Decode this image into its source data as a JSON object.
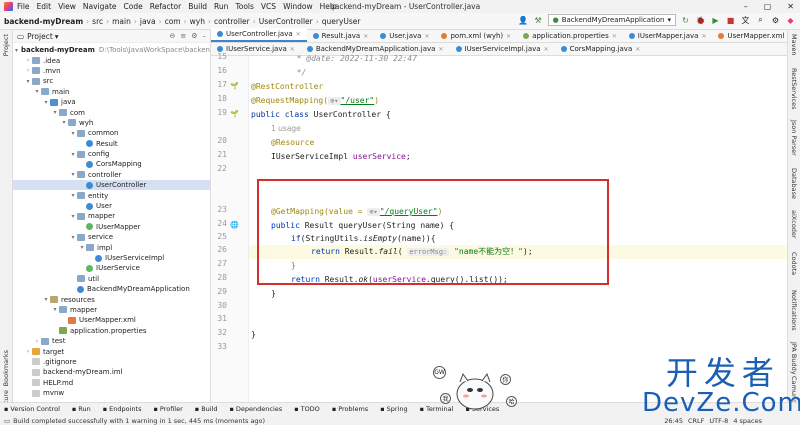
{
  "menubar": {
    "items": [
      "File",
      "Edit",
      "View",
      "Navigate",
      "Code",
      "Refactor",
      "Build",
      "Run",
      "Tools",
      "VCS",
      "Window",
      "Help"
    ],
    "window_title": "backend-myDream - UserController.java"
  },
  "breadcrumb": [
    "backend-myDream",
    "src",
    "main",
    "java",
    "com",
    "wyh",
    "controller",
    "UserController",
    "queryUser"
  ],
  "run_config": "BackendMyDreamApplication",
  "project_panel": {
    "title": "Project"
  },
  "tree": [
    {
      "d": 0,
      "t": "v",
      "i": "folder",
      "label": "backend-myDream",
      "path": "D:\\Tools\\JavaWorkSpace\\backend-m"
    },
    {
      "d": 1,
      "t": ">",
      "i": "folder",
      "label": ".idea"
    },
    {
      "d": 1,
      "t": ">",
      "i": "folder",
      "label": ".mvn"
    },
    {
      "d": 1,
      "t": "v",
      "i": "folder",
      "label": "src"
    },
    {
      "d": 2,
      "t": "v",
      "i": "folder",
      "label": "main"
    },
    {
      "d": 3,
      "t": "v",
      "i": "src",
      "label": "java"
    },
    {
      "d": 4,
      "t": "v",
      "i": "folder",
      "label": "com"
    },
    {
      "d": 5,
      "t": "v",
      "i": "folder",
      "label": "wyh"
    },
    {
      "d": 6,
      "t": "v",
      "i": "folder",
      "label": "common"
    },
    {
      "d": 7,
      "t": "",
      "i": "class",
      "label": "Result"
    },
    {
      "d": 6,
      "t": "v",
      "i": "folder",
      "label": "config"
    },
    {
      "d": 7,
      "t": "",
      "i": "class",
      "label": "CorsMapping"
    },
    {
      "d": 6,
      "t": "v",
      "i": "folder",
      "label": "controller"
    },
    {
      "d": 7,
      "t": "",
      "i": "class",
      "label": "UserController"
    },
    {
      "d": 6,
      "t": "v",
      "i": "folder",
      "label": "entity"
    },
    {
      "d": 7,
      "t": "",
      "i": "class",
      "label": "User"
    },
    {
      "d": 6,
      "t": "v",
      "i": "folder",
      "label": "mapper"
    },
    {
      "d": 7,
      "t": "",
      "i": "iface",
      "label": "IUserMapper"
    },
    {
      "d": 6,
      "t": "v",
      "i": "folder",
      "label": "service"
    },
    {
      "d": 7,
      "t": "v",
      "i": "folder",
      "label": "impl"
    },
    {
      "d": 8,
      "t": "",
      "i": "class",
      "label": "IUserServiceImpl"
    },
    {
      "d": 7,
      "t": "",
      "i": "iface",
      "label": "IUserService"
    },
    {
      "d": 6,
      "t": "",
      "i": "folder",
      "label": "util"
    },
    {
      "d": 6,
      "t": "",
      "i": "class",
      "label": "BackendMyDreamApplication"
    },
    {
      "d": 3,
      "t": "v",
      "i": "res",
      "label": "resources"
    },
    {
      "d": 4,
      "t": "v",
      "i": "folder",
      "label": "mapper"
    },
    {
      "d": 5,
      "t": "",
      "i": "xml",
      "label": "UserMapper.xml"
    },
    {
      "d": 4,
      "t": "",
      "i": "prop",
      "label": "application.properties"
    },
    {
      "d": 2,
      "t": ">",
      "i": "folder",
      "label": "test"
    },
    {
      "d": 1,
      "t": ">",
      "i": "target",
      "label": "target"
    },
    {
      "d": 1,
      "t": "",
      "i": "file",
      "label": ".gitignore"
    },
    {
      "d": 1,
      "t": "",
      "i": "file",
      "label": "backend-myDream.iml"
    },
    {
      "d": 1,
      "t": "",
      "i": "file",
      "label": "HELP.md"
    },
    {
      "d": 1,
      "t": "",
      "i": "file",
      "label": "mvnw"
    }
  ],
  "tabs_row1": [
    {
      "label": "UserController.java",
      "active": true
    },
    {
      "label": "Result.java"
    },
    {
      "label": "User.java"
    },
    {
      "label": "pom.xml (wyh)"
    },
    {
      "label": "application.properties"
    },
    {
      "label": "IUserMapper.java"
    },
    {
      "label": "UserMapper.xml"
    }
  ],
  "tabs_row2": [
    {
      "label": "IUserService.java"
    },
    {
      "label": "BackendMyDreamApplication.java"
    },
    {
      "label": "IUserServiceImpl.java"
    },
    {
      "label": "CorsMapping.java"
    }
  ],
  "line_numbers": [
    "15",
    "16",
    "17",
    "18",
    "19",
    "",
    "20",
    "21",
    "22",
    "23",
    "24",
    "25",
    "26",
    "27",
    "28",
    "29",
    "30",
    "31",
    "32",
    "33"
  ],
  "code": {
    "l15": "  * @date: 2022-11-30 22:47",
    "l16": "  */",
    "l17": "@RestController",
    "l18a": "@RequestMapping(",
    "l18b": "\"/user\"",
    "l18c": ")",
    "l19a": "public class ",
    "l19b": "UserController {",
    "usage": "1 usage",
    "l20": "@Resource",
    "l21a": "IUserServiceImpl ",
    "l21b": "userService",
    "l21c": ";",
    "l23a": "@GetMapping(value = ",
    "l23b": "\"/queryUser\"",
    "l23c": ")",
    "l24a": "public ",
    "l24b": "Result queryUser(String name) {",
    "l25a": "if",
    "l25b": "(StringUtils.",
    "l25c": "isEmpty",
    "l25d": "(name)){",
    "l26a": "return ",
    "l26b": "Result.",
    "l26c": "fail",
    "l26d": "( ",
    "l26hint": "errorMsg:",
    "l26e": " \"name不能为空！\"",
    "l26f": ");",
    "l27": "}",
    "l28a": "return ",
    "l28b": "Result.",
    "l28c": "ok",
    "l28d": "(",
    "l28e": "userService",
    "l28f": ".query().list());",
    "l29": "}",
    "l32": "}"
  },
  "left_strip": [
    "Project",
    "Bookmarks",
    "Structure"
  ],
  "right_strip": [
    "Maven",
    "RestServices",
    "Json Parser",
    "Database",
    "aiXcoder",
    "Codota",
    "Notifications",
    "JPA Buddy",
    "RNS Camunda"
  ],
  "toolwindows": [
    "Version Control",
    "Run",
    "Endpoints",
    "Profiler",
    "Build",
    "Dependencies",
    "TODO",
    "Problems",
    "Spring",
    "Terminal",
    "Services"
  ],
  "status_msg": "Build completed successfully with 1 warning in 1 sec, 445 ms (moments ago)",
  "status_right": [
    "26:45",
    "CRLF",
    "UTF-8",
    "4 spaces"
  ],
  "watermark": {
    "cn": "开发者",
    "en": "DevZe.Com"
  },
  "cat_bubbles": [
    "GW",
    "我",
    "你",
    "哈"
  ]
}
